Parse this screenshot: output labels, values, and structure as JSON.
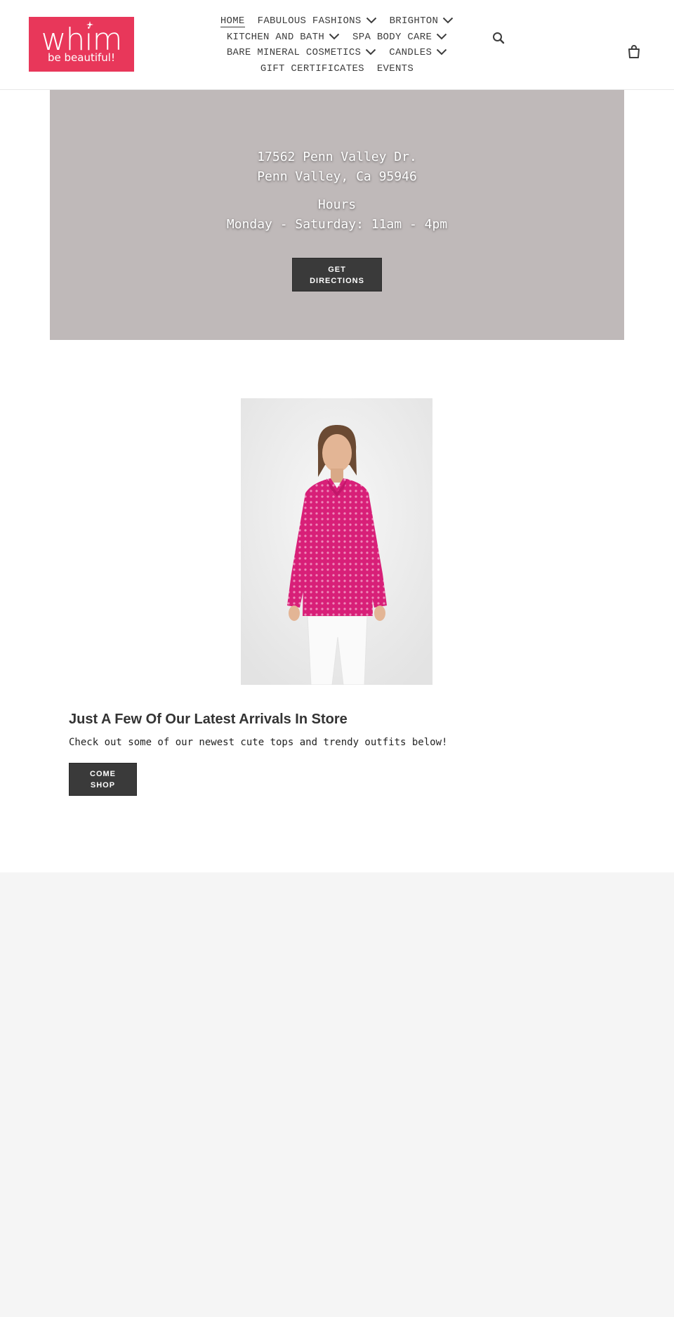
{
  "header": {
    "logo": {
      "word": "whim",
      "tagline": "be beautiful!",
      "color": "#e8375a"
    },
    "nav": [
      [
        {
          "label": "HOME",
          "active": true,
          "dropdown": false
        },
        {
          "label": "FABULOUS FASHIONS",
          "dropdown": true
        },
        {
          "label": "BRIGHTON",
          "dropdown": true
        }
      ],
      [
        {
          "label": "KITCHEN AND BATH",
          "dropdown": true
        },
        {
          "label": "SPA BODY CARE",
          "dropdown": true
        }
      ],
      [
        {
          "label": "BARE MINERAL COSMETICS",
          "dropdown": true
        },
        {
          "label": "CANDLES",
          "dropdown": true
        }
      ],
      [
        {
          "label": "GIFT CERTIFICATES",
          "dropdown": false
        },
        {
          "label": "EVENTS",
          "dropdown": false
        }
      ]
    ],
    "icons": {
      "search": "search-icon",
      "cart": "cart-icon"
    }
  },
  "hero": {
    "address_line1": "17562 Penn Valley Dr.",
    "address_line2": "Penn Valley, Ca 95946",
    "hours_title": "Hours",
    "hours": "Monday - Saturday: 11am - 4pm",
    "button_line1": "GET",
    "button_line2": "DIRECTIONS",
    "background_color": "#bfb9b9"
  },
  "feature": {
    "title": "Just A Few Of Our Latest Arrivals In Store",
    "text": "Check out some of our newest cute tops and trendy outfits below!",
    "button_line1": "COME",
    "button_line2": "SHOP",
    "image_colors": {
      "top": "#d81f78",
      "pants": "#fafafa"
    }
  },
  "footer": {
    "background_color": "#f5f5f5"
  }
}
